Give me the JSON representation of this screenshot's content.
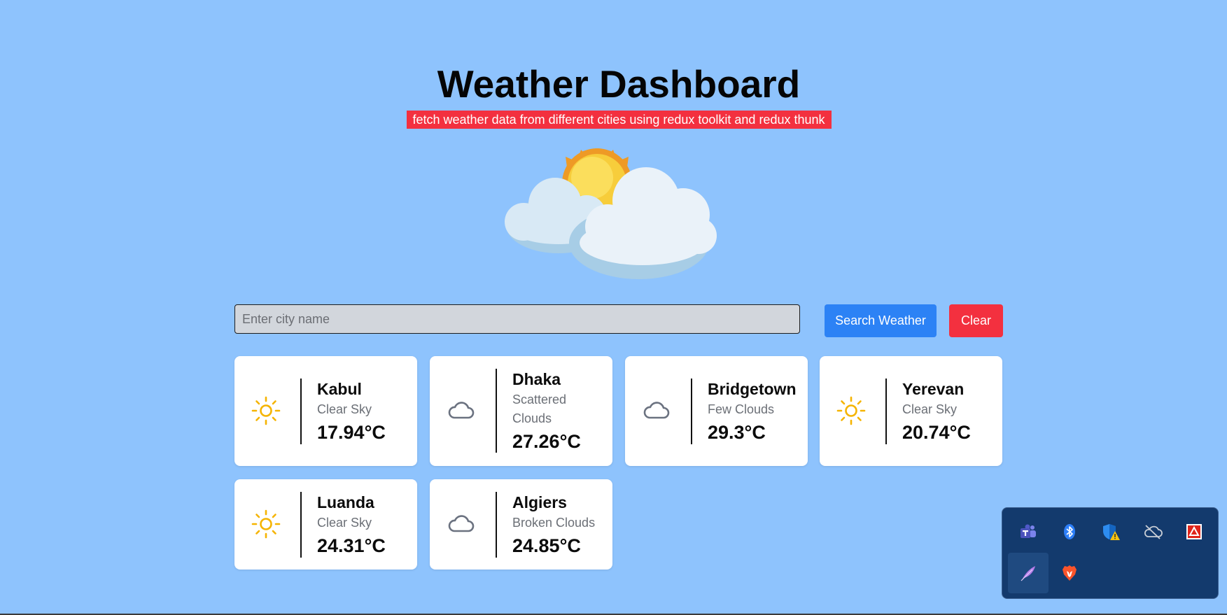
{
  "header": {
    "title": "Weather Dashboard",
    "subtitle": "fetch weather data from different cities using redux toolkit and redux thunk"
  },
  "search": {
    "placeholder": "Enter city name",
    "value": "",
    "search_label": "Search Weather",
    "clear_label": "Clear"
  },
  "cards": [
    {
      "city": "Kabul",
      "description": "Clear Sky",
      "temperature": "17.94°C",
      "icon": "sun-icon"
    },
    {
      "city": "Dhaka",
      "description": "Scattered Clouds",
      "temperature": "27.26°C",
      "icon": "cloud-icon"
    },
    {
      "city": "Bridgetown",
      "description": "Few Clouds",
      "temperature": "29.3°C",
      "icon": "cloud-icon"
    },
    {
      "city": "Yerevan",
      "description": "Clear Sky",
      "temperature": "20.74°C",
      "icon": "sun-icon"
    },
    {
      "city": "Luanda",
      "description": "Clear Sky",
      "temperature": "24.31°C",
      "icon": "sun-icon"
    },
    {
      "city": "Algiers",
      "description": "Broken Clouds",
      "temperature": "24.85°C",
      "icon": "cloud-icon"
    }
  ],
  "tray": {
    "icons": [
      "teams-icon",
      "bluetooth-icon",
      "security-warning-icon",
      "onedrive-icon",
      "adobe-icon",
      "feather-icon",
      "brave-icon"
    ]
  },
  "colors": {
    "background": "#8ec3fd",
    "accent_blue": "#2c82f5",
    "accent_red": "#f3303f",
    "sun": "#f5b400",
    "cloud_outline": "#6b7280"
  }
}
